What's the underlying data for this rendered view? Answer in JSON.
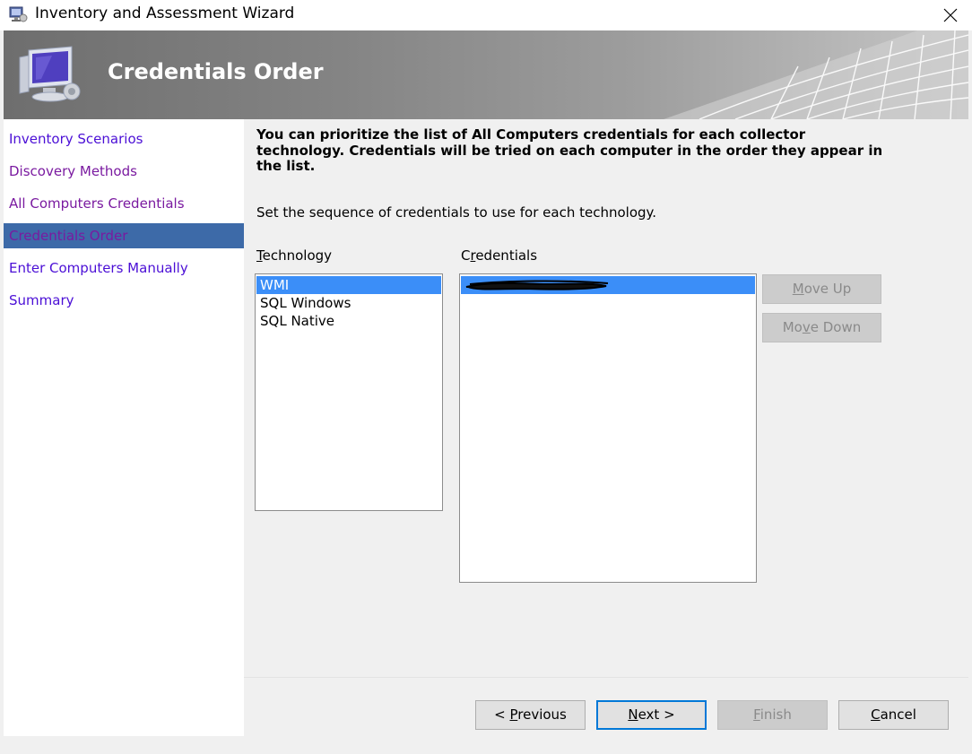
{
  "window": {
    "title": "Inventory and Assessment Wizard",
    "icon": "wizard-computer-icon",
    "close_icon": "close-icon"
  },
  "header": {
    "title": "Credentials Order",
    "icon": "monitor-icon"
  },
  "nav": {
    "items": [
      {
        "label": "Inventory Scenarios",
        "state": "link"
      },
      {
        "label": "Discovery Methods",
        "state": "visited"
      },
      {
        "label": "All Computers Credentials",
        "state": "visited"
      },
      {
        "label": "Credentials Order",
        "state": "active"
      },
      {
        "label": "Enter Computers Manually",
        "state": "link"
      },
      {
        "label": "Summary",
        "state": "link"
      }
    ]
  },
  "main": {
    "intro": "You can prioritize the list of All Computers credentials for each collector technology. Credentials will be tried on each computer in the order they appear in the list.",
    "instruction": "Set the sequence of credentials to use for each technology.",
    "technology": {
      "label_mnemonic": "T",
      "label_rest": "echnology",
      "items": [
        "WMI",
        "SQL Windows",
        "SQL Native"
      ],
      "selected_index": 0
    },
    "credentials": {
      "label_pre": "C",
      "label_mnemonic": "r",
      "label_rest": "edentials",
      "items": [
        "[redacted]"
      ],
      "selected_index": 0
    },
    "move_up": {
      "pre": "",
      "mnemonic": "M",
      "post": "ove Up"
    },
    "move_down": {
      "pre": "Mo",
      "mnemonic": "v",
      "post": "e Down"
    }
  },
  "footer": {
    "previous": {
      "pre": "< ",
      "mnemonic": "P",
      "post": "revious"
    },
    "next": {
      "pre": "",
      "mnemonic": "N",
      "post": "ext >"
    },
    "finish": {
      "pre": "",
      "mnemonic": "F",
      "post": "inish"
    },
    "cancel": {
      "pre": "",
      "mnemonic": "C",
      "post": "ancel"
    }
  },
  "colors": {
    "nav_link": "#4b0fd6",
    "nav_visited": "#7a1aa0",
    "nav_active_bg": "#3d6aa8",
    "selection": "#3b8ef8",
    "default_button_border": "#0078d7"
  }
}
